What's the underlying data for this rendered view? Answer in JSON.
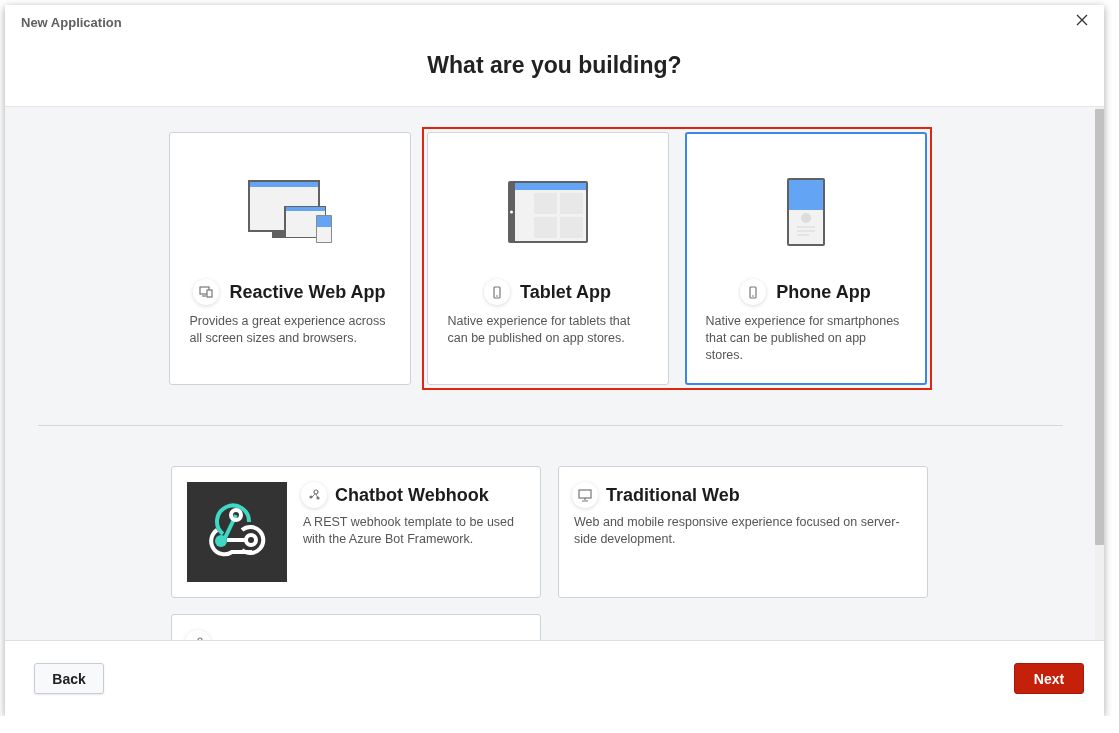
{
  "window": {
    "title": "New Application"
  },
  "heading": "What are you building?",
  "app_types": [
    {
      "kind": "responsive",
      "title": "Reactive Web App",
      "description": "Provides a great experience across all screen sizes and browsers.",
      "selected": false,
      "highlighted": false
    },
    {
      "kind": "tablet",
      "title": "Tablet App",
      "description": "Native experience for tablets that can be published on app stores.",
      "selected": false,
      "highlighted": true
    },
    {
      "kind": "phone",
      "title": "Phone App",
      "description": "Native experience for smartphones that can be published on app stores.",
      "selected": true,
      "highlighted": true
    }
  ],
  "templates": [
    {
      "kind": "chatbot",
      "title": "Chatbot Webhook",
      "description": "A REST webhook template to be used with the Azure Bot Framework."
    },
    {
      "kind": "traditional",
      "title": "Traditional Web",
      "description": "Web and mobile responsive experience focused on server-side development."
    },
    {
      "kind": "service"
    }
  ],
  "footer": {
    "back": "Back",
    "next": "Next"
  }
}
